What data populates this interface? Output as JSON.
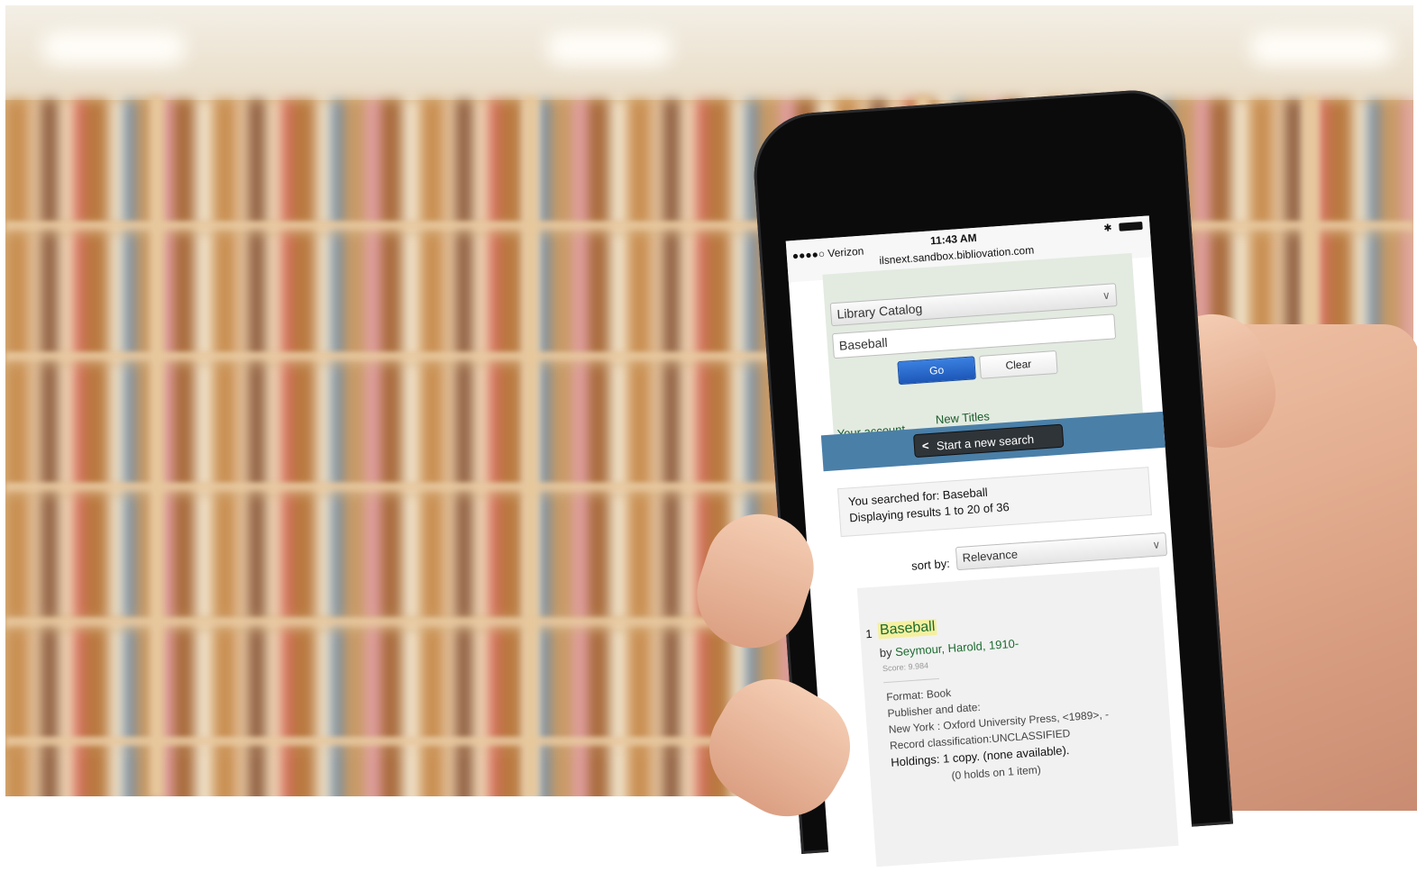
{
  "status_bar": {
    "carrier": "●●●●○ Verizon",
    "time": "11:43 AM",
    "url": "ilsnext.sandbox.bibliovation.com",
    "bluetooth_icon": "bluetooth-icon",
    "battery_icon": "battery-icon"
  },
  "search_form": {
    "catalog_select": "Library Catalog",
    "query_value": "Baseball",
    "go_label": "Go",
    "clear_label": "Clear"
  },
  "nav_links": {
    "account": "Your account",
    "new_titles": "New Titles"
  },
  "new_search": {
    "label": "Start a new search",
    "icon": "chevron-left-icon"
  },
  "summary": {
    "searched_for": "You searched for: Baseball",
    "displaying": "Displaying results 1 to 20 of 36"
  },
  "sort": {
    "label": "sort by:",
    "value": "Relevance"
  },
  "results": [
    {
      "number": "1",
      "title": "Baseball",
      "by_prefix": "by",
      "author": "Seymour, Harold, 1910-",
      "score": "Score: 9.984",
      "format": "Format: Book",
      "publisher_label": "Publisher and date:",
      "publisher": "New York : Oxford University Press, <1989>, -",
      "classification": "Record classification:UNCLASSIFIED",
      "holdings": "Holdings: 1 copy. (none available).",
      "holds": "(0 holds on 1 item)"
    }
  ],
  "colors": {
    "panel_bg": "#e3ebe1",
    "go_button": "#1d57b8",
    "bar_blue": "#4a7fa8",
    "link_green": "#1b6b2f",
    "highlight": "#f5f0a0"
  }
}
